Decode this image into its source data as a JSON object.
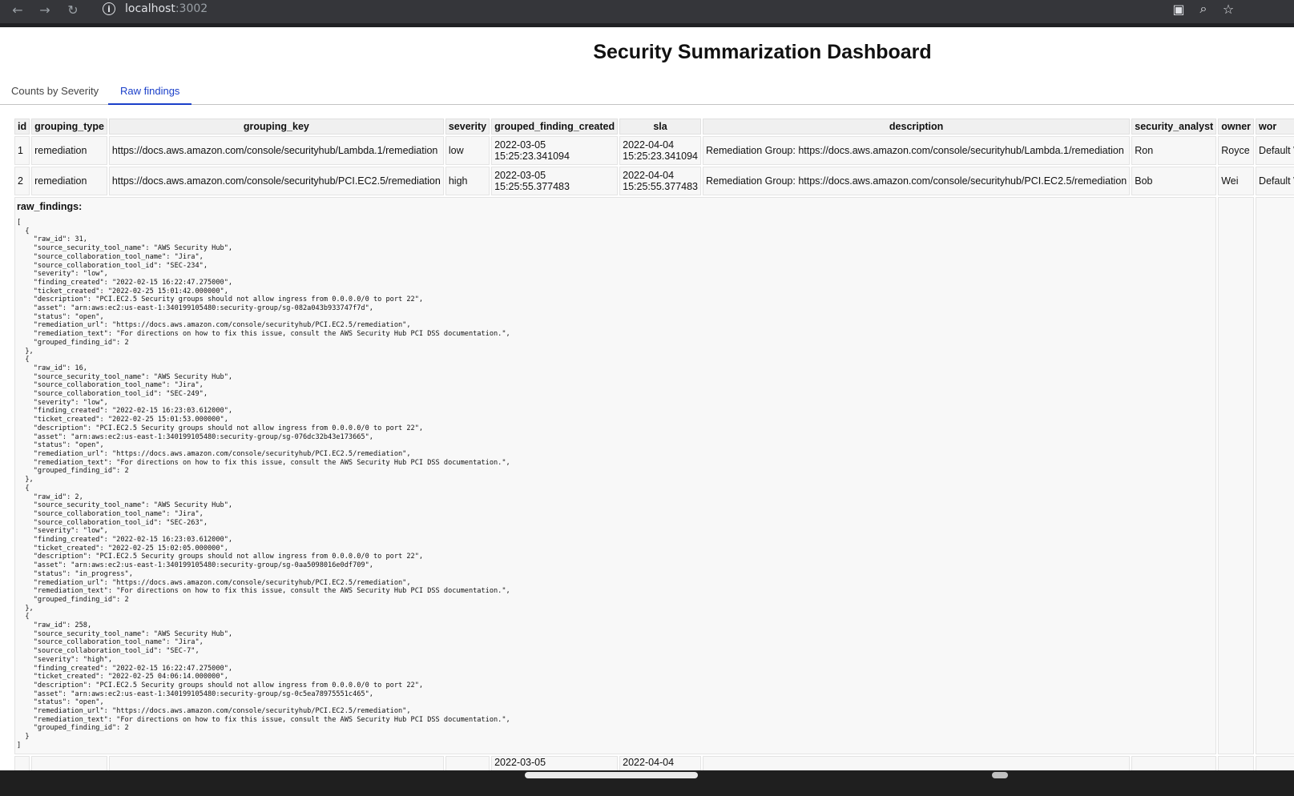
{
  "browser": {
    "url_host": "localhost",
    "url_port": ":3002",
    "back_icon": "arrow-left-icon",
    "forward_icon": "arrow-right-icon",
    "reload_icon": "reload-icon",
    "info_icon": "info-icon",
    "info_glyph": "i"
  },
  "page": {
    "title": "Security Summarization Dashboard"
  },
  "tabs": [
    {
      "label": "Counts by Severity",
      "active": false
    },
    {
      "label": "Raw findings",
      "active": true
    }
  ],
  "table": {
    "columns": [
      "id",
      "grouping_type",
      "grouping_key",
      "severity",
      "grouped_finding_created",
      "sla",
      "description",
      "security_analyst",
      "owner",
      "wor"
    ],
    "rows": [
      {
        "id": "1",
        "grouping_type": "remediation",
        "grouping_key": "https://docs.aws.amazon.com/console/securityhub/Lambda.1/remediation",
        "severity": "low",
        "created_date": "2022-03-05",
        "created_time": "15:25:23.341094",
        "sla_date": "2022-04-04",
        "sla_time": "15:25:23.341094",
        "description": "Remediation Group: https://docs.aws.amazon.com/console/securityhub/Lambda.1/remediation",
        "security_analyst": "Ron",
        "owner": "Royce",
        "workflow": "Default Wor"
      },
      {
        "id": "2",
        "grouping_type": "remediation",
        "grouping_key": "https://docs.aws.amazon.com/console/securityhub/PCI.EC2.5/remediation",
        "severity": "high",
        "created_date": "2022-03-05",
        "created_time": "15:25:55.377483",
        "sla_date": "2022-04-04",
        "sla_time": "15:25:55.377483",
        "description": "Remediation Group: https://docs.aws.amazon.com/console/securityhub/PCI.EC2.5/remediation",
        "security_analyst": "Bob",
        "owner": "Wei",
        "workflow": "Default Wor"
      }
    ],
    "raw_findings_label": "raw_findings:",
    "raw_findings_text": "[\n  {\n    \"raw_id\": 31,\n    \"source_security_tool_name\": \"AWS Security Hub\",\n    \"source_collaboration_tool_name\": \"Jira\",\n    \"source_collaboration_tool_id\": \"SEC-234\",\n    \"severity\": \"low\",\n    \"finding_created\": \"2022-02-15 16:22:47.275000\",\n    \"ticket_created\": \"2022-02-25 15:01:42.000000\",\n    \"description\": \"PCI.EC2.5 Security groups should not allow ingress from 0.0.0.0/0 to port 22\",\n    \"asset\": \"arn:aws:ec2:us-east-1:340199105480:security-group/sg-082a043b933747f7d\",\n    \"status\": \"open\",\n    \"remediation_url\": \"https://docs.aws.amazon.com/console/securityhub/PCI.EC2.5/remediation\",\n    \"remediation_text\": \"For directions on how to fix this issue, consult the AWS Security Hub PCI DSS documentation.\",\n    \"grouped_finding_id\": 2\n  },\n  {\n    \"raw_id\": 16,\n    \"source_security_tool_name\": \"AWS Security Hub\",\n    \"source_collaboration_tool_name\": \"Jira\",\n    \"source_collaboration_tool_id\": \"SEC-249\",\n    \"severity\": \"low\",\n    \"finding_created\": \"2022-02-15 16:23:03.612000\",\n    \"ticket_created\": \"2022-02-25 15:01:53.000000\",\n    \"description\": \"PCI.EC2.5 Security groups should not allow ingress from 0.0.0.0/0 to port 22\",\n    \"asset\": \"arn:aws:ec2:us-east-1:340199105480:security-group/sg-076dc32b43e173665\",\n    \"status\": \"open\",\n    \"remediation_url\": \"https://docs.aws.amazon.com/console/securityhub/PCI.EC2.5/remediation\",\n    \"remediation_text\": \"For directions on how to fix this issue, consult the AWS Security Hub PCI DSS documentation.\",\n    \"grouped_finding_id\": 2\n  },\n  {\n    \"raw_id\": 2,\n    \"source_security_tool_name\": \"AWS Security Hub\",\n    \"source_collaboration_tool_name\": \"Jira\",\n    \"source_collaboration_tool_id\": \"SEC-263\",\n    \"severity\": \"low\",\n    \"finding_created\": \"2022-02-15 16:23:03.612000\",\n    \"ticket_created\": \"2022-02-25 15:02:05.000000\",\n    \"description\": \"PCI.EC2.5 Security groups should not allow ingress from 0.0.0.0/0 to port 22\",\n    \"asset\": \"arn:aws:ec2:us-east-1:340199105480:security-group/sg-0aa5098016e0df709\",\n    \"status\": \"in_progress\",\n    \"remediation_url\": \"https://docs.aws.amazon.com/console/securityhub/PCI.EC2.5/remediation\",\n    \"remediation_text\": \"For directions on how to fix this issue, consult the AWS Security Hub PCI DSS documentation.\",\n    \"grouped_finding_id\": 2\n  },\n  {\n    \"raw_id\": 258,\n    \"source_security_tool_name\": \"AWS Security Hub\",\n    \"source_collaboration_tool_name\": \"Jira\",\n    \"source_collaboration_tool_id\": \"SEC-7\",\n    \"severity\": \"high\",\n    \"finding_created\": \"2022-02-15 16:22:47.275000\",\n    \"ticket_created\": \"2022-02-25 04:06:14.000000\",\n    \"description\": \"PCI.EC2.5 Security groups should not allow ingress from 0.0.0.0/0 to port 22\",\n    \"asset\": \"arn:aws:ec2:us-east-1:340199105480:security-group/sg-0c5ea78975551c465\",\n    \"status\": \"open\",\n    \"remediation_url\": \"https://docs.aws.amazon.com/console/securityhub/PCI.EC2.5/remediation\",\n    \"remediation_text\": \"For directions on how to fix this issue, consult the AWS Security Hub PCI DSS documentation.\",\n    \"grouped_finding_id\": 2\n  }\n]",
    "partial_row": {
      "created_date": "2022-03-05",
      "sla_date": "2022-04-04"
    }
  },
  "colors": {
    "chrome_bg": "#35363a",
    "tab_active": "#1a3fc9",
    "taskbar_bg": "#1f1f1f"
  }
}
